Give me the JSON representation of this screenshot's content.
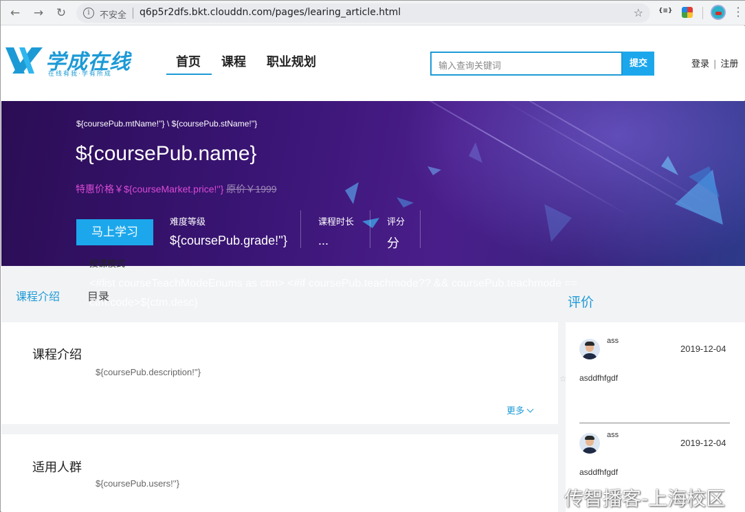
{
  "browser": {
    "security_label": "不安全",
    "url": "q6p5r2dfs.bkt.clouddn.com/pages/learing_article.html",
    "ext_label": "{≡}"
  },
  "site": {
    "logo_text": "学成在线",
    "logo_slogan": "在线有我·学有所成",
    "nav": [
      "首页",
      "课程",
      "职业规划"
    ],
    "search_placeholder": "输入查询关键词",
    "search_button": "提交",
    "login": "登录",
    "register": "注册",
    "auth_separator": "|"
  },
  "banner": {
    "crumb": "${coursePub.mtName!''} \\ ${coursePub.stName!''}",
    "course_name": "${coursePub.name}",
    "sale_price": "特惠价格￥${courseMarket.price!''}",
    "original_price": "原价￥1999",
    "learn_button": "马上学习",
    "stats": [
      {
        "label": "难度等级",
        "value": "${coursePub.grade!''}"
      },
      {
        "label": "课程时长",
        "value": "..."
      },
      {
        "label": "评分",
        "value": "分"
      }
    ],
    "teach_mode_label": "授课模式",
    "teach_mode_code": "<#list courseTeachModeEnums as ctm> <#if coursePub.teachmode?? && coursePub.teachmode == ctm.code>${ctm.desc}"
  },
  "tabs": [
    "课程介绍",
    "目录"
  ],
  "rating_title": "评价",
  "sections": [
    {
      "title": "课程介绍",
      "body": "${coursePub.description!''}",
      "more": "更多"
    },
    {
      "title": "适用人群",
      "body": "${coursePub.users!''}"
    }
  ],
  "comments": [
    {
      "user": "ass",
      "date": "2019-12-04",
      "text": "asddfhfgdf"
    },
    {
      "user": "ass",
      "date": "2019-12-04",
      "text": "asddfhfgdf"
    }
  ],
  "watermark": "传智播客-上海校区",
  "colors": {
    "brand": "#1c9ad6",
    "button": "#1ca7ec",
    "sale": "#d94bd6",
    "banner": "#3a1575"
  }
}
